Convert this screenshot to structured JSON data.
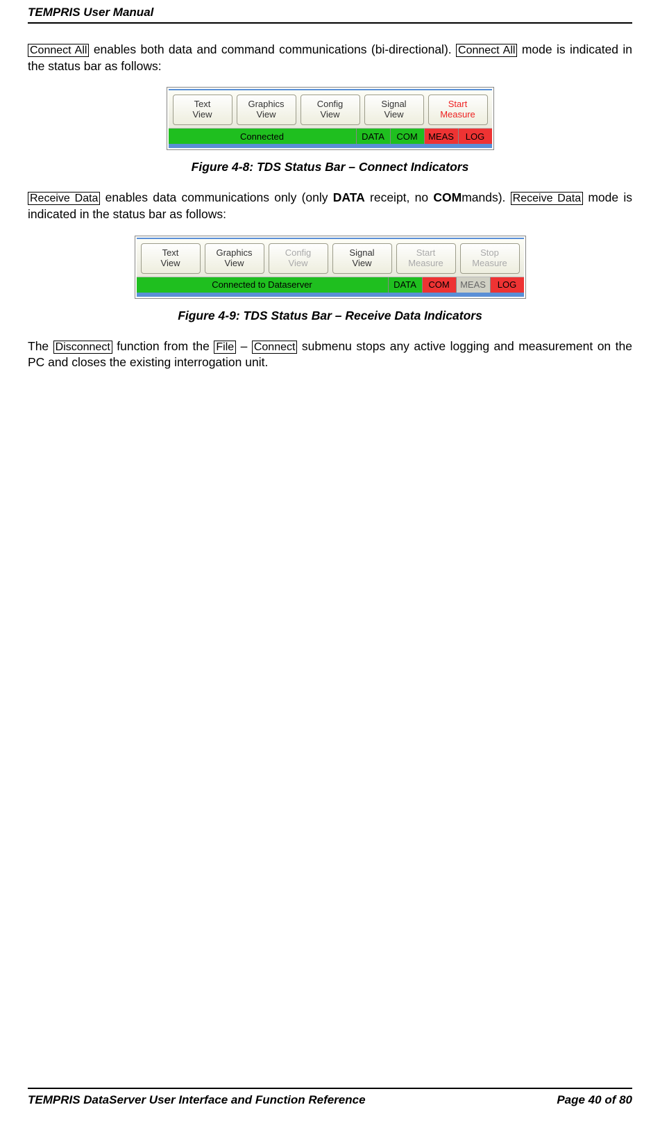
{
  "header": {
    "title": "TEMPRIS User Manual"
  },
  "p1": {
    "btn1": "Connect All",
    "t1": " enables both data and command communications (bi-directional). ",
    "btn2": "Connect All",
    "t2": " mode is indicated in the status bar as follows:"
  },
  "fig1": {
    "buttons": [
      {
        "l1": "Text",
        "l2": "View",
        "cls": ""
      },
      {
        "l1": "Graphics",
        "l2": "View",
        "cls": ""
      },
      {
        "l1": "Config",
        "l2": "View",
        "cls": ""
      },
      {
        "l1": "Signal",
        "l2": "View",
        "cls": ""
      },
      {
        "l1": "Start",
        "l2": "Measure",
        "cls": "red"
      }
    ],
    "status_label": "Connected",
    "inds": [
      {
        "t": "DATA",
        "c": "g"
      },
      {
        "t": "COM",
        "c": "g"
      },
      {
        "t": "MEAS",
        "c": "r"
      },
      {
        "t": "LOG",
        "c": "r"
      }
    ],
    "caption": "Figure 4-8: TDS Status Bar – Connect Indicators"
  },
  "p2": {
    "btn1": "Receive Data",
    "t1": " enables data communications only (only ",
    "b1": "DATA",
    "t2": " receipt, no ",
    "b2": "COM",
    "t3": "mands). ",
    "btn2": "Receive Data",
    "t4": " mode is indicated in the status bar as follows:"
  },
  "fig2": {
    "buttons": [
      {
        "l1": "Text",
        "l2": "View",
        "cls": ""
      },
      {
        "l1": "Graphics",
        "l2": "View",
        "cls": ""
      },
      {
        "l1": "Config",
        "l2": "View",
        "cls": "gray"
      },
      {
        "l1": "Signal",
        "l2": "View",
        "cls": ""
      },
      {
        "l1": "Start",
        "l2": "Measure",
        "cls": "gray"
      },
      {
        "l1": "Stop",
        "l2": "Measure",
        "cls": "gray"
      }
    ],
    "status_label": "Connected to Dataserver",
    "inds": [
      {
        "t": "DATA",
        "c": "g"
      },
      {
        "t": "COM",
        "c": "r"
      },
      {
        "t": "MEAS",
        "c": "gr"
      },
      {
        "t": "LOG",
        "c": "r"
      }
    ],
    "caption": "Figure 4-9: TDS Status Bar – Receive Data Indicators"
  },
  "p3": {
    "t1": "The ",
    "btn1": "Disconnect",
    "t2": " function from the ",
    "btn2": "File",
    "t3": " – ",
    "btn3": "Connect",
    "t4": " submenu stops any active logging and measurement on the PC and closes the existing interrogation unit."
  },
  "footer": {
    "left": "TEMPRIS DataServer User Interface and Function Reference",
    "right": "Page 40 of 80"
  }
}
